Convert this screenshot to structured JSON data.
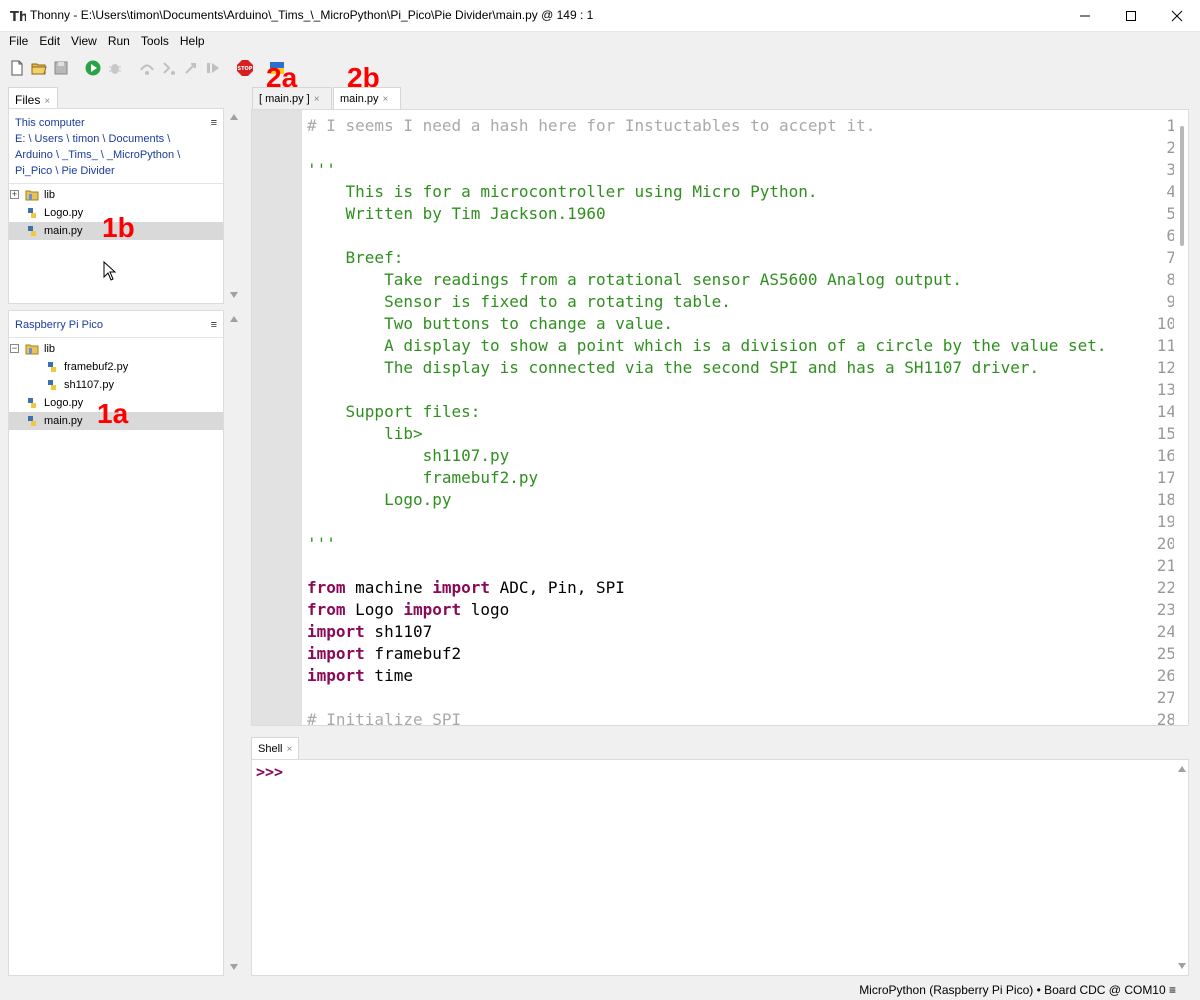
{
  "window": {
    "title": "Thonny  -  E:\\Users\\timon\\Documents\\Arduino\\_Tims_\\_MicroPython\\Pi_Pico\\Pie Divider\\main.py  @  149 : 1"
  },
  "menu": [
    "File",
    "Edit",
    "View",
    "Run",
    "Tools",
    "Help"
  ],
  "annotations": {
    "a1": "1a",
    "b1": "1b",
    "a2": "2a",
    "b2": "2b"
  },
  "files_panel": {
    "tab_label": "Files",
    "computer": {
      "header": "This computer",
      "path_lines": [
        "E: \\ Users \\ timon \\ Documents \\",
        "Arduino \\ _Tims_ \\ _MicroPython \\",
        "Pi_Pico \\ Pie Divider"
      ],
      "items": [
        "lib",
        "Logo.py",
        "main.py"
      ]
    },
    "pico": {
      "header": "Raspberry Pi Pico",
      "items": [
        "lib",
        "framebuf2.py",
        "sh1107.py",
        "Logo.py",
        "main.py"
      ]
    },
    "menu_glyph": "≡"
  },
  "editor_tabs": [
    "[ main.py ]",
    "main.py"
  ],
  "close_glyph": "×",
  "editor": {
    "line_numbers": [
      "1",
      "2",
      "3",
      "4",
      "5",
      "6",
      "7",
      "8",
      "9",
      "10",
      "11",
      "12",
      "13",
      "14",
      "15",
      "16",
      "17",
      "18",
      "19",
      "20",
      "21",
      "22",
      "23",
      "24",
      "25",
      "26",
      "27",
      "28"
    ],
    "comment_1": "# I seems I need a hash here for Instuctables to accept it.",
    "triple_quote": "'''",
    "doc": [
      "    This is for a microcontroller using Micro Python.",
      "    Written by Tim Jackson.1960",
      "",
      "    Breef:",
      "        Take readings from a rotational sensor AS5600 Analog output.",
      "        Sensor is fixed to a rotating table.",
      "        Two buttons to change a value.",
      "        A display to show a point which is a division of a circle by the value set.",
      "        The display is connected via the second SPI and has a SH1107 driver.",
      "",
      "    Support files:",
      "        lib>",
      "            sh1107.py",
      "            framebuf2.py",
      "        Logo.py",
      ""
    ],
    "kw_from": "from",
    "kw_import": "import",
    "l22_mid": " machine ",
    "l22_end": " ADC, Pin, SPI",
    "l23_mid": " Logo ",
    "l23_end": " logo",
    "l24_end": " sh1107",
    "l25_end": " framebuf2",
    "l26_end": " time",
    "comment_28": "# Initialize SPI"
  },
  "shell": {
    "tab_label": "Shell",
    "prompt": ">>>"
  },
  "status": {
    "text": "MicroPython (Raspberry Pi Pico)  •  Board CDC @ COM10  ≡"
  }
}
